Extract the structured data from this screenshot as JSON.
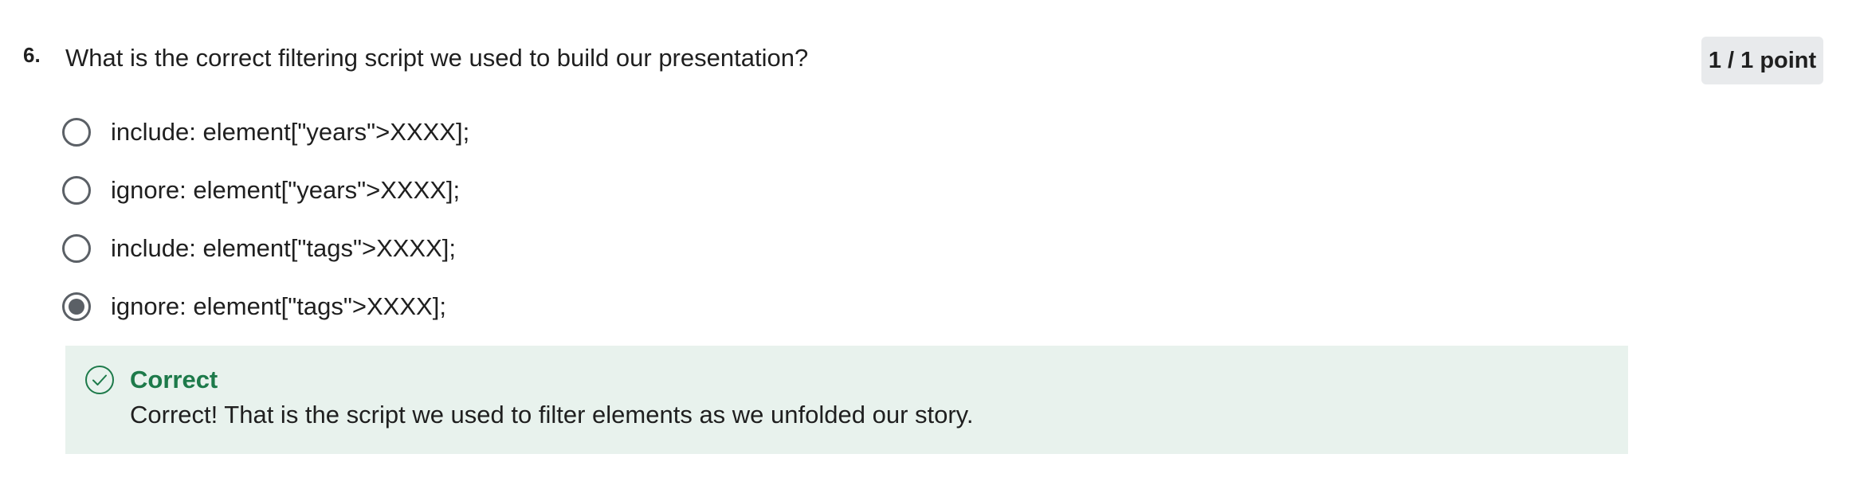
{
  "question": {
    "number": "6.",
    "text": "What is the correct filtering script we used to build our presentation?",
    "score": "1 / 1 point"
  },
  "options": [
    {
      "label": "include: element[\"years\">XXXX];",
      "selected": false
    },
    {
      "label": "ignore: element[\"years\">XXXX];",
      "selected": false
    },
    {
      "label": "include: element[\"tags\">XXXX];",
      "selected": false
    },
    {
      "label": "ignore: element[\"tags\">XXXX];",
      "selected": true
    }
  ],
  "feedback": {
    "title": "Correct",
    "text": "Correct! That is the script we used to filter elements as we unfolded our story.",
    "icon": "check-circle-icon"
  },
  "colors": {
    "success": "#1d7a4a",
    "feedback_bg": "#e8f2ed",
    "badge_bg": "#e8eaec",
    "radio": "#5b6066"
  }
}
